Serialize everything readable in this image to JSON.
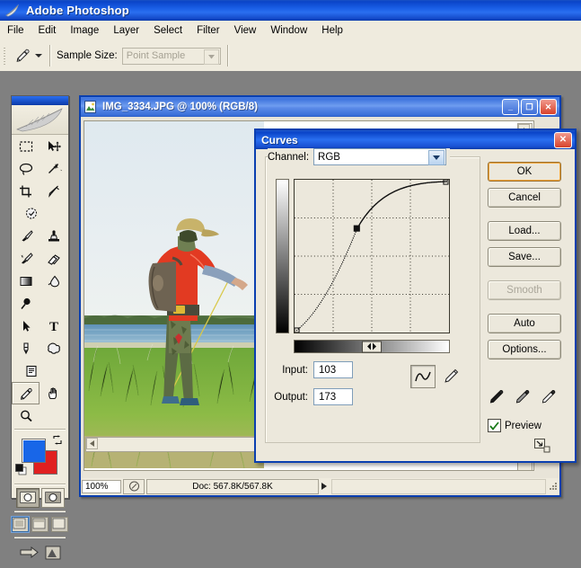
{
  "app": {
    "title": "Adobe Photoshop",
    "title_icon": "photoshop-feather-icon",
    "menus": [
      "File",
      "Edit",
      "Image",
      "Layer",
      "Select",
      "Filter",
      "View",
      "Window",
      "Help"
    ]
  },
  "options_bar": {
    "tool_icon": "eyedropper-icon",
    "caret_icon": "chevron-down-icon",
    "sample_size_label": "Sample Size:",
    "sample_size_value": "Point Sample",
    "sample_size_arrow": "chevron-down-icon"
  },
  "toolbox": {
    "logo_icon": "feather-logo-icon",
    "tools": [
      "marquee-rectangular-icon",
      "move-icon",
      "lasso-icon",
      "magic-wand-icon",
      "crop-icon",
      "slice-icon",
      "healing-brush-icon",
      "brush-icon",
      "clone-stamp-icon",
      "history-brush-icon",
      "eraser-icon",
      "gradient-icon",
      "blur-smudge-icon",
      "dodge-burn-icon",
      "path-selection-icon",
      "type-icon",
      "pen-icon",
      "custom-shape-icon",
      "notes-icon",
      "eyedropper-icon",
      "hand-icon",
      "zoom-icon"
    ],
    "selected_tool": "eyedropper-icon",
    "foreground_color": "#1866e8",
    "background_color": "#e02020",
    "swap_colors_icon": "swap-colors-icon",
    "default_colors_icon": "default-colors-icon",
    "quickmask": [
      "standard-mode-icon",
      "quickmask-mode-icon"
    ],
    "screen_modes": [
      "standard-screen-icon",
      "full-screen-menubar-icon",
      "full-screen-icon"
    ],
    "jump_to": [
      "jump-to-imageready-icon",
      "imageready-icon"
    ]
  },
  "document": {
    "title": "IMG_3334.JPG @ 100% (RGB/8)",
    "title_icon": "image-document-icon",
    "window_buttons": {
      "minimize": "minimize-icon",
      "maximize": "maximize-icon",
      "close": "close-icon"
    },
    "status": {
      "zoom": "100%",
      "preview_icon": "document-preview-icon",
      "doc_size": "Doc: 567.8K/567.8K",
      "menu_arrow_icon": "triangle-right-icon",
      "resize_grip_icon": "resize-grip-icon"
    },
    "photo_description": "fisherman-at-lakeside"
  },
  "curves_dialog": {
    "title": "Curves",
    "close_icon": "close-icon",
    "channel_label": "Channel:",
    "channel_value": "RGB",
    "channel_arrow_icon": "chevron-down-icon",
    "vertical_gradient": "output-gradient",
    "horizontal_gradient": "input-gradient",
    "gradient_toggle_icon": "left-right-arrows-icon",
    "input_label": "Input:",
    "input_value": "103",
    "output_label": "Output:",
    "output_value": "173",
    "curve_tool_icon": "curve-tool-icon",
    "pencil_tool_icon": "pencil-tool-icon",
    "buttons": [
      {
        "label": "OK",
        "state": "default"
      },
      {
        "label": "Cancel",
        "state": "normal"
      },
      {
        "label": "Load...",
        "state": "normal"
      },
      {
        "label": "Save...",
        "state": "normal"
      },
      {
        "label": "Smooth",
        "state": "disabled"
      },
      {
        "label": "Auto",
        "state": "normal"
      },
      {
        "label": "Options...",
        "state": "normal"
      }
    ],
    "eyedroppers": [
      "set-black-point-icon",
      "set-gray-point-icon",
      "set-white-point-icon"
    ],
    "preview_label": "Preview",
    "preview_checked": true,
    "preview_check_icon": "checkmark-icon",
    "resize_grip_icon": "resize-grip-icon"
  },
  "chart_data": {
    "type": "line",
    "title": "Curves (RGB tonal curve)",
    "xlabel": "Input",
    "ylabel": "Output",
    "xlim": [
      0,
      255
    ],
    "ylim": [
      0,
      255
    ],
    "grid": true,
    "grid_divisions": 4,
    "legend": "none",
    "series": [
      {
        "name": "RGB curve",
        "points": [
          [
            0,
            0
          ],
          [
            32,
            48
          ],
          [
            64,
            102
          ],
          [
            103,
            173
          ],
          [
            128,
            198
          ],
          [
            160,
            222
          ],
          [
            192,
            239
          ],
          [
            224,
            250
          ],
          [
            255,
            255
          ]
        ]
      }
    ],
    "control_points": [
      {
        "input": 0,
        "output": 0,
        "selected": false
      },
      {
        "input": 103,
        "output": 173,
        "selected": true
      },
      {
        "input": 255,
        "output": 255,
        "selected": false
      }
    ],
    "annotations": [
      "Input: 103",
      "Output: 173"
    ]
  }
}
